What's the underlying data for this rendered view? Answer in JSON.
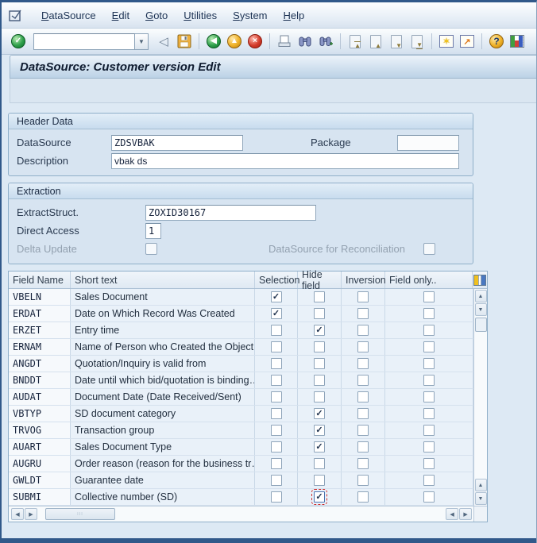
{
  "title": "DataSource: Customer version Edit",
  "menu_bar": {
    "items": [
      "DataSource",
      "Edit",
      "Goto",
      "Utilities",
      "System",
      "Help"
    ]
  },
  "toolbar": {
    "command_value": "",
    "buttons": [
      "enter",
      "command-field",
      "back-step",
      "save",
      "back",
      "exit",
      "cancel",
      "print",
      "find",
      "find-next",
      "first-page",
      "previous-page",
      "next-page",
      "last-page",
      "new-session",
      "create-shortcut",
      "help",
      "customize-layout"
    ]
  },
  "glyphs": {
    "check": "✓",
    "dropdown": "▼",
    "back_triangle": "◁",
    "arrow_left": "◀",
    "arrow_up": "▲",
    "arrow_down": "▼",
    "arrow_right": "▶",
    "cancel_x": "×",
    "question": "?",
    "star": "✶",
    "shortcut_arrow": "↗"
  },
  "header_data": {
    "section_title": "Header Data",
    "datasource_label": "DataSource",
    "datasource_value": "ZDSVBAK",
    "package_label": "Package",
    "package_value": "",
    "description_label": "Description",
    "description_value": "vbak ds"
  },
  "extraction": {
    "section_title": "Extraction",
    "extractstruct_label": "ExtractStruct.",
    "extractstruct_value": "ZOXID30167",
    "direct_access_label": "Direct Access",
    "direct_access_value": "1",
    "delta_update_label": "Delta Update",
    "delta_update_checked": false,
    "reconciliation_label": "DataSource for Reconciliation",
    "reconciliation_checked": false
  },
  "field_table": {
    "columns": [
      "Field Name",
      "Short text",
      "Selection",
      "Hide field",
      "Inversion",
      "Field only.."
    ],
    "rows": [
      {
        "field": "VBELN",
        "text": "Sales Document",
        "selection": true,
        "hide": false,
        "inversion": false,
        "field_only": false
      },
      {
        "field": "ERDAT",
        "text": "Date on Which Record Was Created",
        "selection": true,
        "hide": false,
        "inversion": false,
        "field_only": false
      },
      {
        "field": "ERZET",
        "text": "Entry time",
        "selection": false,
        "hide": true,
        "inversion": false,
        "field_only": false
      },
      {
        "field": "ERNAM",
        "text": "Name of Person who Created the Object",
        "selection": false,
        "hide": false,
        "inversion": false,
        "field_only": false
      },
      {
        "field": "ANGDT",
        "text": "Quotation/Inquiry is valid from",
        "selection": false,
        "hide": false,
        "inversion": false,
        "field_only": false
      },
      {
        "field": "BNDDT",
        "text": "Date until which bid/quotation is binding…",
        "selection": false,
        "hide": false,
        "inversion": false,
        "field_only": false
      },
      {
        "field": "AUDAT",
        "text": "Document Date (Date Received/Sent)",
        "selection": false,
        "hide": false,
        "inversion": false,
        "field_only": false
      },
      {
        "field": "VBTYP",
        "text": "SD document category",
        "selection": false,
        "hide": true,
        "inversion": false,
        "field_only": false
      },
      {
        "field": "TRVOG",
        "text": "Transaction group",
        "selection": false,
        "hide": true,
        "inversion": false,
        "field_only": false
      },
      {
        "field": "AUART",
        "text": "Sales Document Type",
        "selection": false,
        "hide": true,
        "inversion": false,
        "field_only": false
      },
      {
        "field": "AUGRU",
        "text": "Order reason (reason for the business tr…",
        "selection": false,
        "hide": false,
        "inversion": false,
        "field_only": false
      },
      {
        "field": "GWLDT",
        "text": "Guarantee date",
        "selection": false,
        "hide": false,
        "inversion": false,
        "field_only": false
      },
      {
        "field": "SUBMI",
        "text": "Collective number (SD)",
        "selection": false,
        "hide": true,
        "inversion": false,
        "field_only": false,
        "focused": "hide"
      }
    ]
  }
}
